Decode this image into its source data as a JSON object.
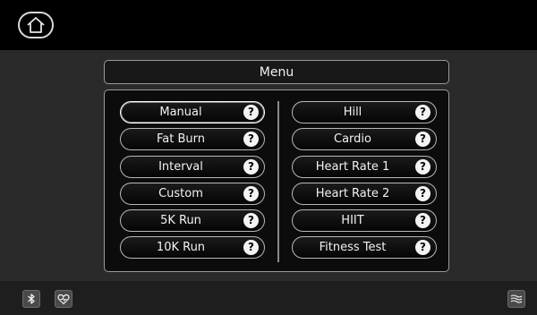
{
  "header": {
    "home_icon": "home-icon"
  },
  "menu": {
    "title": "Menu",
    "left_column": [
      {
        "label": "Manual",
        "selected": true
      },
      {
        "label": "Fat Burn",
        "selected": false
      },
      {
        "label": "Interval",
        "selected": false
      },
      {
        "label": "Custom",
        "selected": false
      },
      {
        "label": "5K Run",
        "selected": false
      },
      {
        "label": "10K Run",
        "selected": false
      }
    ],
    "right_column": [
      {
        "label": "Hill",
        "selected": false
      },
      {
        "label": "Cardio",
        "selected": false
      },
      {
        "label": "Heart Rate 1",
        "selected": false
      },
      {
        "label": "Heart Rate 2",
        "selected": false
      },
      {
        "label": "HIIT",
        "selected": false
      },
      {
        "label": "Fitness Test",
        "selected": false
      }
    ],
    "help_glyph": "?"
  },
  "footer": {
    "icons": [
      "bluetooth-icon",
      "heart-icon",
      "wave-icon"
    ]
  }
}
